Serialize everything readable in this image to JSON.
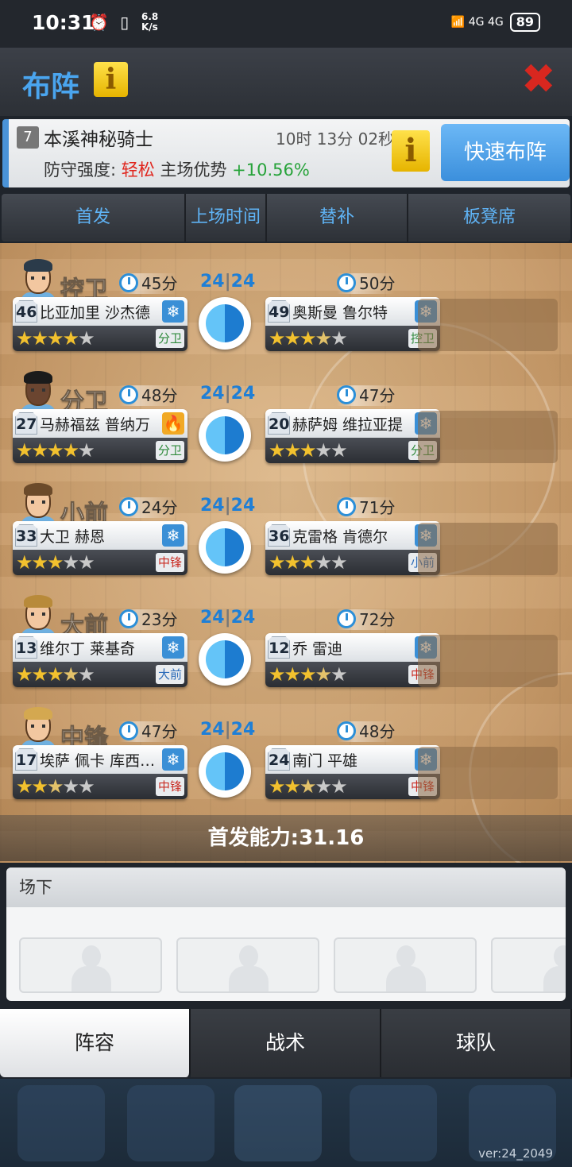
{
  "status_bar": {
    "time": "10:31",
    "icons": "⏰ ▯ ",
    "speed_top": "6.8",
    "speed_bottom": "K/s",
    "network": "📶 4G 4G",
    "battery": "89"
  },
  "header": {
    "title": "布阵",
    "info_icon": "info-icon",
    "close_icon": "close-icon"
  },
  "opponent": {
    "level": "7",
    "name": "本溪神秘骑士",
    "timer": "10时 13分 02秒",
    "defense_label": "防守强度:",
    "defense_value": "轻松",
    "home_label": "主场优势",
    "home_value": "+10.56%",
    "quick_button": "快速布阵"
  },
  "tabs": [
    "首发",
    "上场时间",
    "替补",
    "板凳席"
  ],
  "rows": [
    {
      "position": "控卫",
      "score_left": "24",
      "score_right": "24",
      "starter": {
        "number": "46",
        "name": "比亚加里 沙杰德",
        "minutes": "45分",
        "stars": 4,
        "role": "分卫",
        "role_color": "g",
        "cond": "snow"
      },
      "sub": {
        "number": "49",
        "name": "奥斯曼 鲁尔特",
        "minutes": "50分",
        "stars": 3.5,
        "role": "控卫",
        "role_color": "g",
        "cond": "snow"
      }
    },
    {
      "position": "分卫",
      "score_left": "24",
      "score_right": "24",
      "starter": {
        "number": "27",
        "name": "马赫福兹 普纳万",
        "minutes": "48分",
        "stars": 4,
        "role": "分卫",
        "role_color": "g",
        "cond": "fire"
      },
      "sub": {
        "number": "20",
        "name": "赫萨姆 维拉亚提",
        "minutes": "47分",
        "stars": 3,
        "role": "分卫",
        "role_color": "g",
        "cond": "snow"
      }
    },
    {
      "position": "小前",
      "score_left": "24",
      "score_right": "24",
      "starter": {
        "number": "33",
        "name": "大卫 赫恩",
        "minutes": "24分",
        "stars": 3,
        "role": "中锋",
        "role_color": "r",
        "cond": "snow"
      },
      "sub": {
        "number": "36",
        "name": "克雷格 肯德尔",
        "minutes": "71分",
        "stars": 3,
        "role": "小前",
        "role_color": "b",
        "cond": "snow"
      }
    },
    {
      "position": "大前",
      "score_left": "24",
      "score_right": "24",
      "starter": {
        "number": "13",
        "name": "维尔丁 莱基奇",
        "minutes": "23分",
        "stars": 3.5,
        "role": "大前",
        "role_color": "b",
        "cond": "snow"
      },
      "sub": {
        "number": "12",
        "name": "乔 雷迪",
        "minutes": "72分",
        "stars": 3.5,
        "role": "中锋",
        "role_color": "r",
        "cond": "snow"
      }
    },
    {
      "position": "中锋",
      "score_left": "24",
      "score_right": "24",
      "starter": {
        "number": "17",
        "name": "埃萨 佩卡 库西…",
        "minutes": "47分",
        "stars": 2.5,
        "role": "中锋",
        "role_color": "r",
        "cond": "snow"
      },
      "sub": {
        "number": "24",
        "name": "南门 平雄",
        "minutes": "48分",
        "stars": 2.5,
        "role": "中锋",
        "role_color": "r",
        "cond": "snow"
      }
    }
  ],
  "power": "首发能力:31.16",
  "bench": {
    "title": "场下"
  },
  "bottom_tabs": [
    "阵容",
    "战术",
    "球队"
  ],
  "version": "ver:24_2049",
  "colors": {
    "accent_blue": "#4aa5ef",
    "gold": "#f2c12e",
    "red": "#e0251d",
    "green": "#27a33a"
  }
}
